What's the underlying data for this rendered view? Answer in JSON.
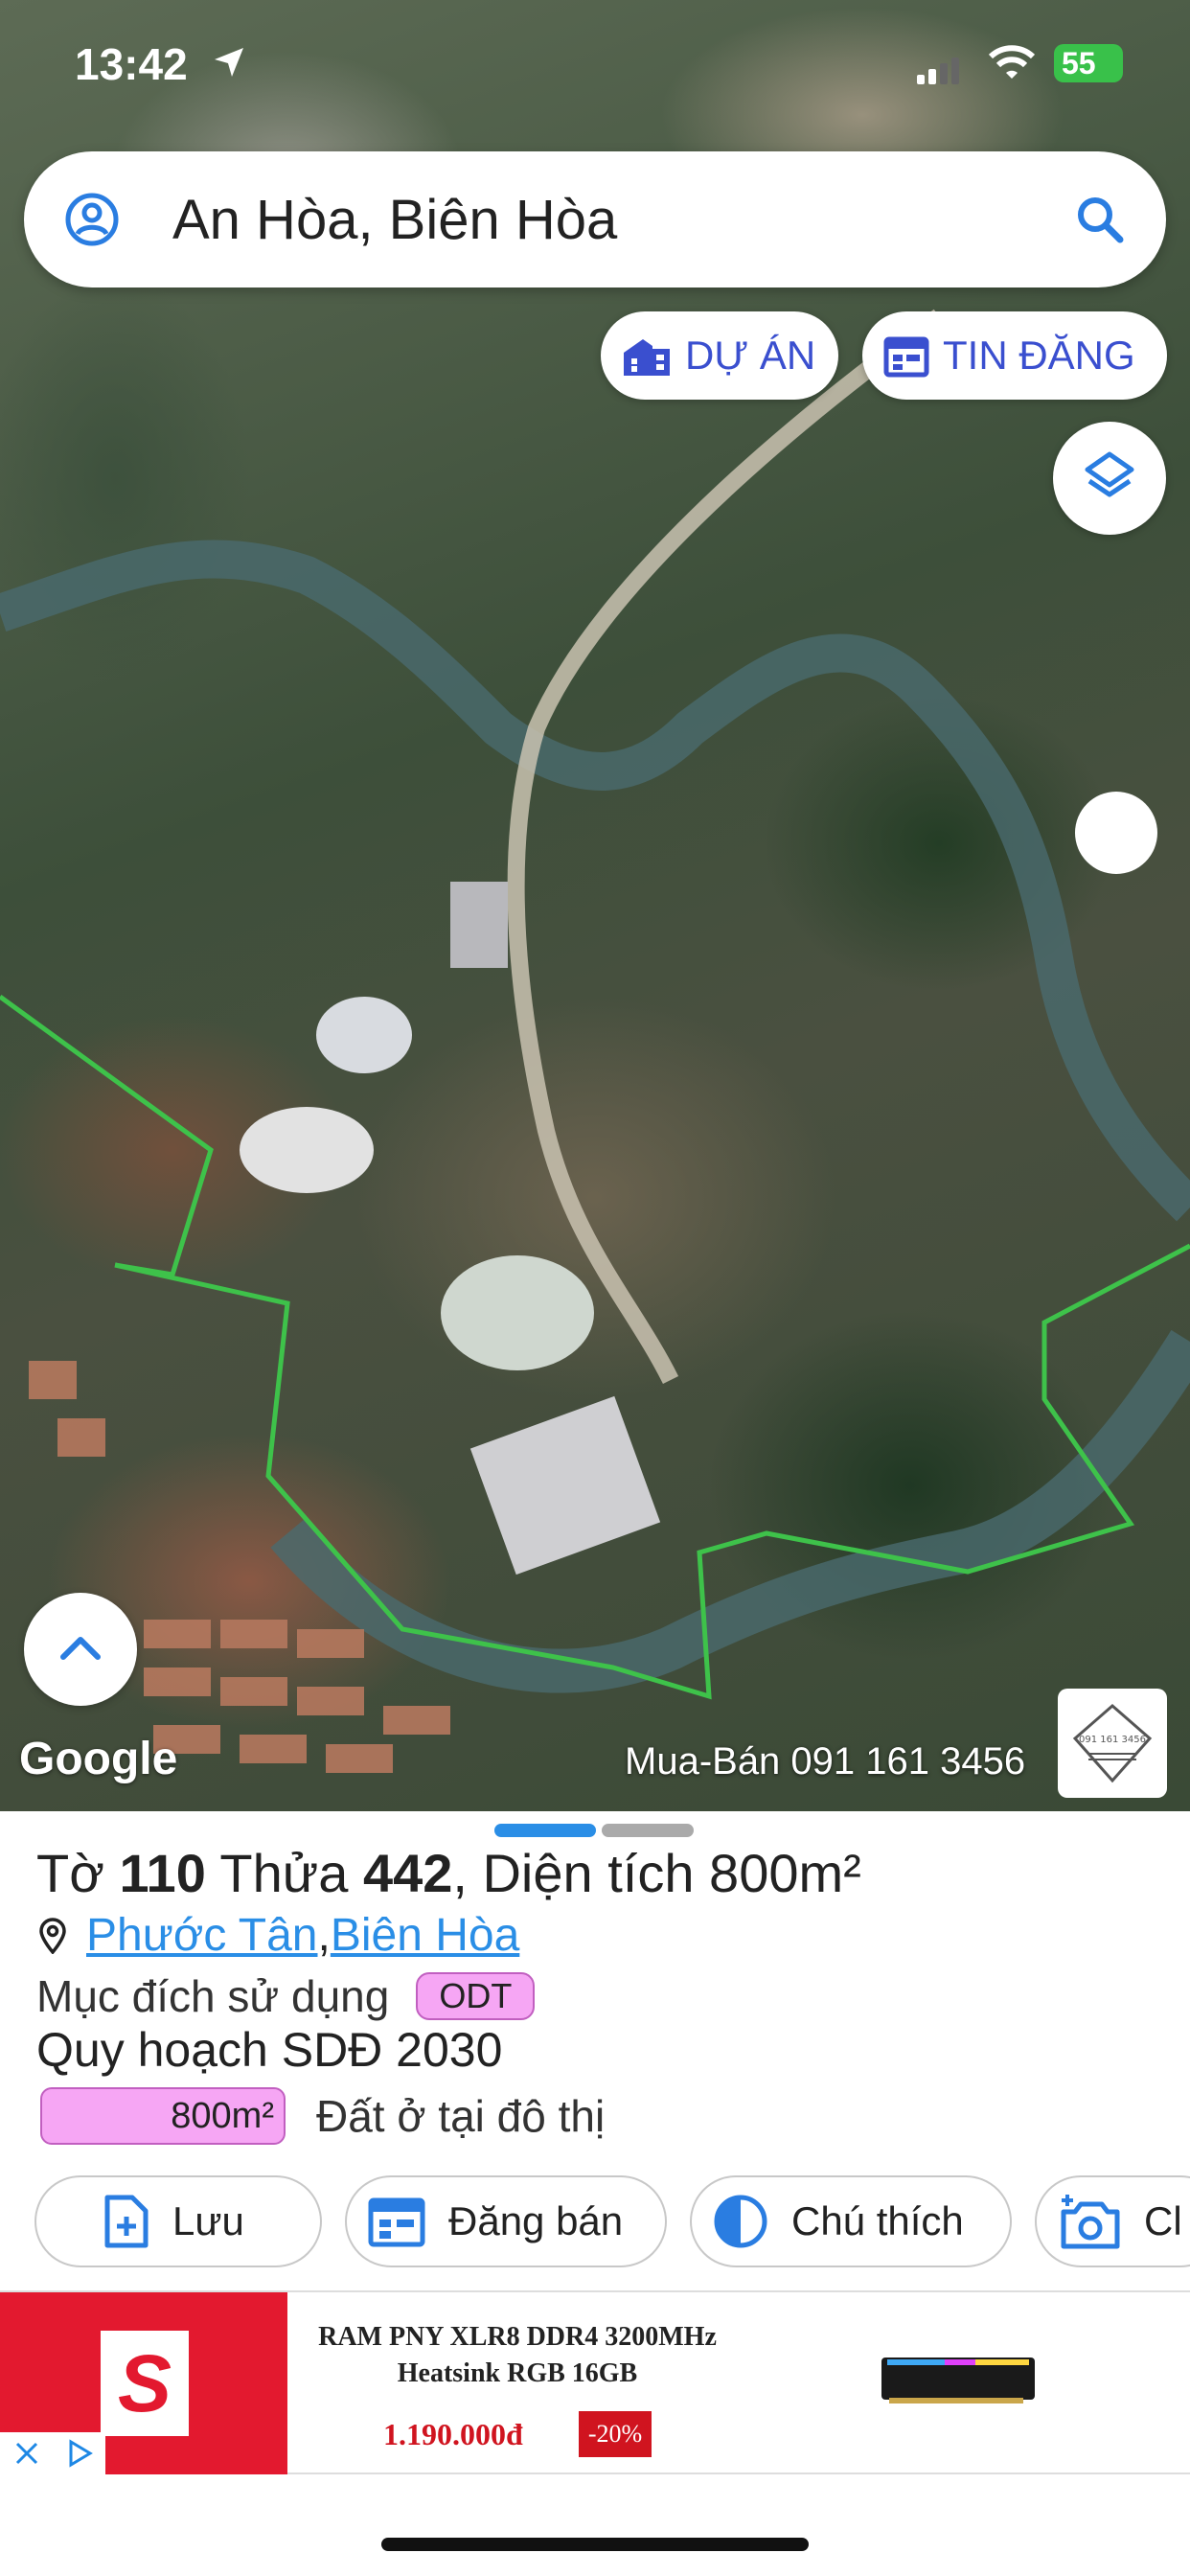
{
  "status_bar": {
    "time": "13:42",
    "battery": "55"
  },
  "search": {
    "query": "An Hòa, Biên Hòa"
  },
  "map": {
    "chips": {
      "project": "DỰ ÁN",
      "listing": "TIN ĐĂNG"
    },
    "logo": "Google",
    "credit": "Mua-Bán 091 161 3456",
    "stamp_text": "091 161 3456"
  },
  "sheet": {
    "title": {
      "prefix": "Tờ ",
      "sheet_no": "110",
      "mid": " Thửa ",
      "parcel_no": "442",
      "area_label": ", Diện tích ",
      "area": "800m²"
    },
    "location": {
      "ward": "Phước Tân",
      "separator": ", ",
      "city": "Biên Hòa"
    },
    "purpose_label": "Mục đích sử dụng",
    "purpose_code": "ODT",
    "planning": "Quy hoạch SDĐ 2030",
    "zone_area": "800m²",
    "zone_desc": "Đất ở tại đô thị",
    "actions": {
      "save": "Lưu",
      "sell": "Đăng bán",
      "legend": "Chú thích",
      "camera": "Cl"
    }
  },
  "ad": {
    "title": "RAM PNY XLR8 DDR4 3200MHz Heatsink RGB 16GB",
    "price": "1.190.000đ",
    "discount": "-20%",
    "logo_letter": "S"
  },
  "colors": {
    "accent": "#3a4fcf",
    "link": "#2a8ee6",
    "badge": "#f6a6f4",
    "boundary": "#3ec24a",
    "ad_red": "#e3192f"
  }
}
